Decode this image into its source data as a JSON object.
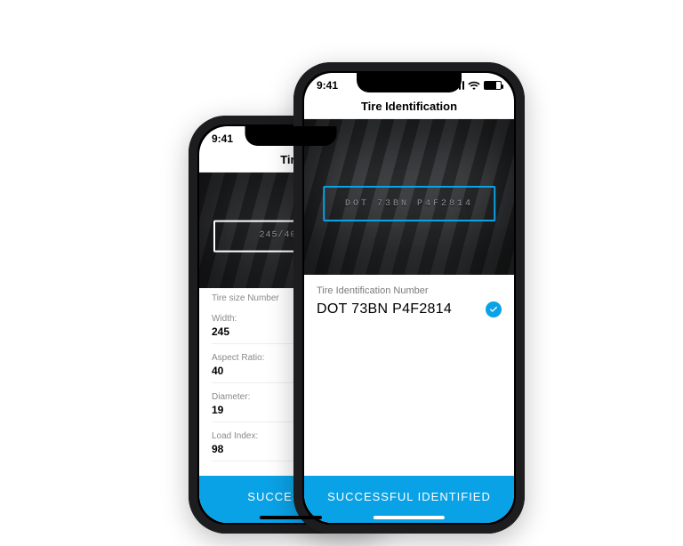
{
  "statusbar": {
    "time": "9:41"
  },
  "front": {
    "title": "Tire Identification",
    "embossed": "DOT 73BN P4F2814",
    "section_label": "Tire Identification Number",
    "result": "DOT 73BN P4F2814",
    "cta": "SUCCESSFUL IDENTIFIED"
  },
  "back": {
    "title": "Tire",
    "embossed": "245/40",
    "section_label": "Tire size Number",
    "rows": [
      {
        "label": "Width:",
        "value": "245"
      },
      {
        "label": "Aspect Ratio:",
        "value": "40"
      },
      {
        "label": "Diameter:",
        "value": "19"
      },
      {
        "label": "Load Index:",
        "value": "98"
      }
    ],
    "cta": "SUCCESSFUL"
  }
}
